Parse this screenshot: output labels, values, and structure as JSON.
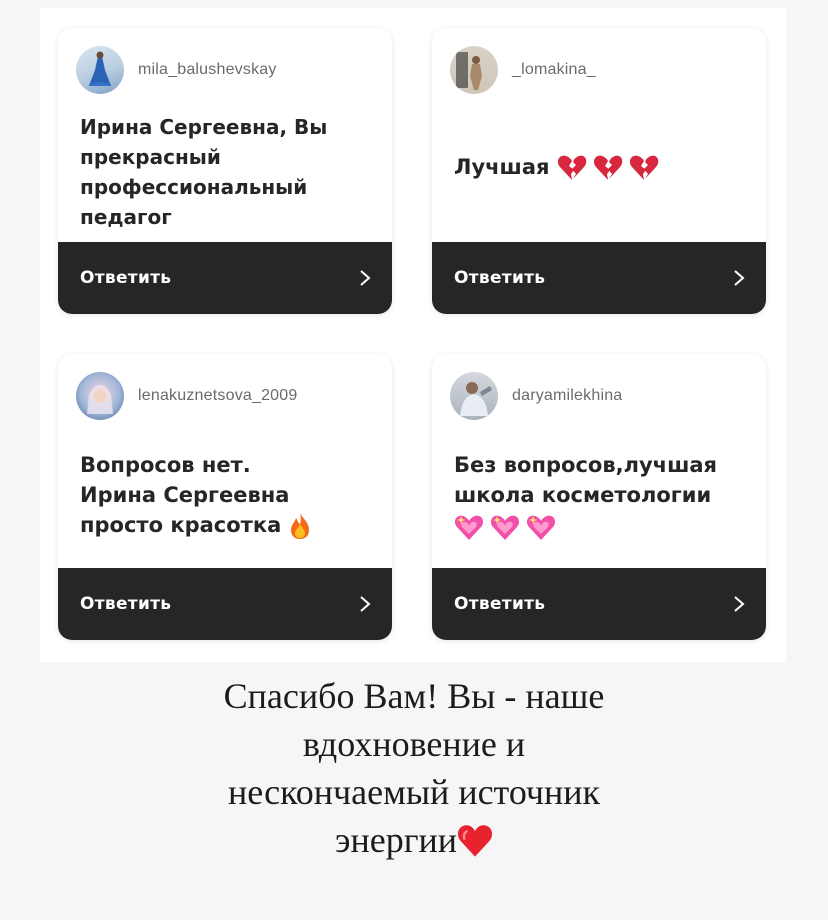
{
  "cards": [
    {
      "username": "mila_balushevskay",
      "message_lines": [
        "Ирина Сергеевна, Вы",
        "прекрасный",
        "профессиональный",
        "педагог"
      ],
      "reply_label": "Ответить"
    },
    {
      "username": "_lomakina_",
      "message": "Лучшая",
      "emojis": [
        "broken-heart",
        "broken-heart",
        "broken-heart"
      ],
      "reply_label": "Ответить"
    },
    {
      "username": "lenakuznetsova_2009",
      "message_lines": [
        "Вопросов нет.",
        "Ирина Сергеевна",
        "просто красотка"
      ],
      "emoji_inline": "fire",
      "reply_label": "Ответить"
    },
    {
      "username": "daryamilekhina",
      "message_lines": [
        "Без вопросов,лучшая",
        "школа косметологии"
      ],
      "emojis": [
        "sparkling-heart",
        "sparkling-heart",
        "sparkling-heart"
      ],
      "reply_label": "Ответить"
    }
  ],
  "caption": {
    "lines": [
      "Спасибо Вам! Вы - наше",
      "вдохновение и",
      "нескончаемый источник",
      "энергии"
    ],
    "emoji": "red-heart"
  },
  "colors": {
    "reply_bar": "#262626",
    "broken_heart": "#d7263d",
    "sparkling_heart": "#f24fa8",
    "red_heart": "#e8232f"
  }
}
